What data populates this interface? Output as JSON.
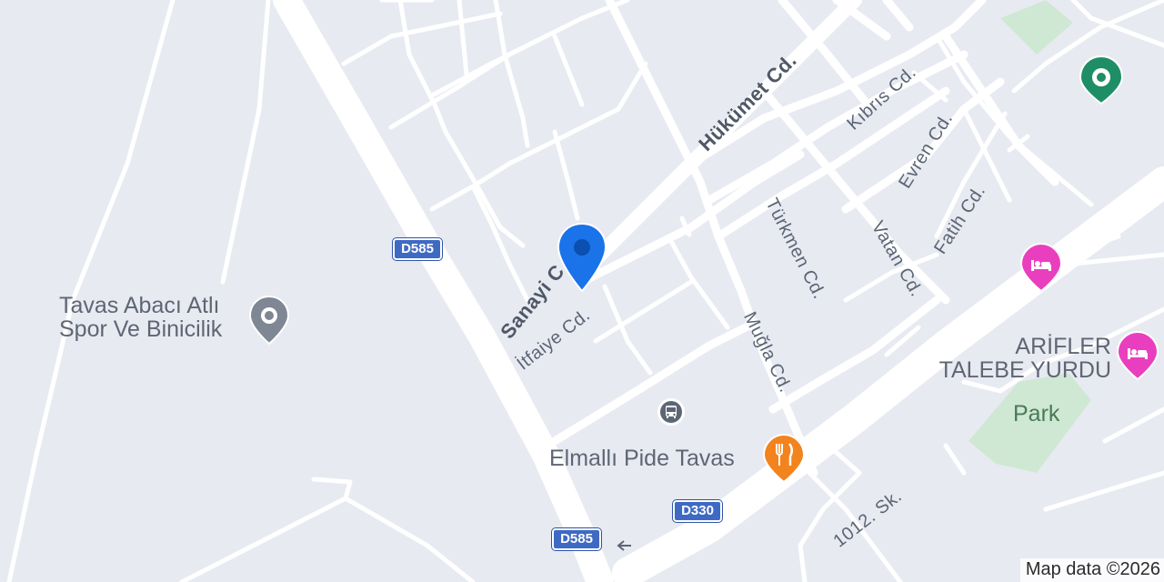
{
  "map": {
    "colors": {
      "background": "#e8eaf2",
      "road": "#ffffff",
      "park": "#cfe8d3",
      "selected_pin": "#1a73e8",
      "hotel": "#e93fbf",
      "food": "#f2831d",
      "generic_poi": "#7e8793",
      "green_poi": "#1e8e66",
      "shield": "#3f6ac4"
    },
    "streets": {
      "hukumet": "Hükümet Cd.",
      "sanayi": "Sanayi C",
      "itfaiye": "İtfaiye Cd.",
      "kibris": "Kıbrıs Cd.",
      "evren": "Evren Cd.",
      "fatih": "Fatih Cd.",
      "turkmen": "Türkmen Cd.",
      "vatan": "Vatan Cd.",
      "mugla": "Muğla Cd.",
      "sk1012": "1012. Sk."
    },
    "shields": {
      "d585_top": "D585",
      "d585_bottom": "D585",
      "d330": "D330"
    },
    "pois": {
      "tavas_abaci_line1": "Tavas Abacı Atlı",
      "tavas_abaci_line2": "Spor Ve Binicilik",
      "arifler_line1": "ARİFLER",
      "arifler_line2": "TALEBE YURDU",
      "park": "Park",
      "elmalli": "Elmallı Pide Tavas"
    },
    "icons": {
      "selected": "location-pin-icon",
      "poi_generic": "place-pin-icon",
      "poi_green": "place-pin-icon",
      "hotel_1": "bed-icon",
      "hotel_2": "bed-icon",
      "restaurant": "fork-knife-icon",
      "bus": "bus-stop-icon",
      "direction": "arrow-left-icon"
    },
    "attribution": "Map data ©2026"
  }
}
